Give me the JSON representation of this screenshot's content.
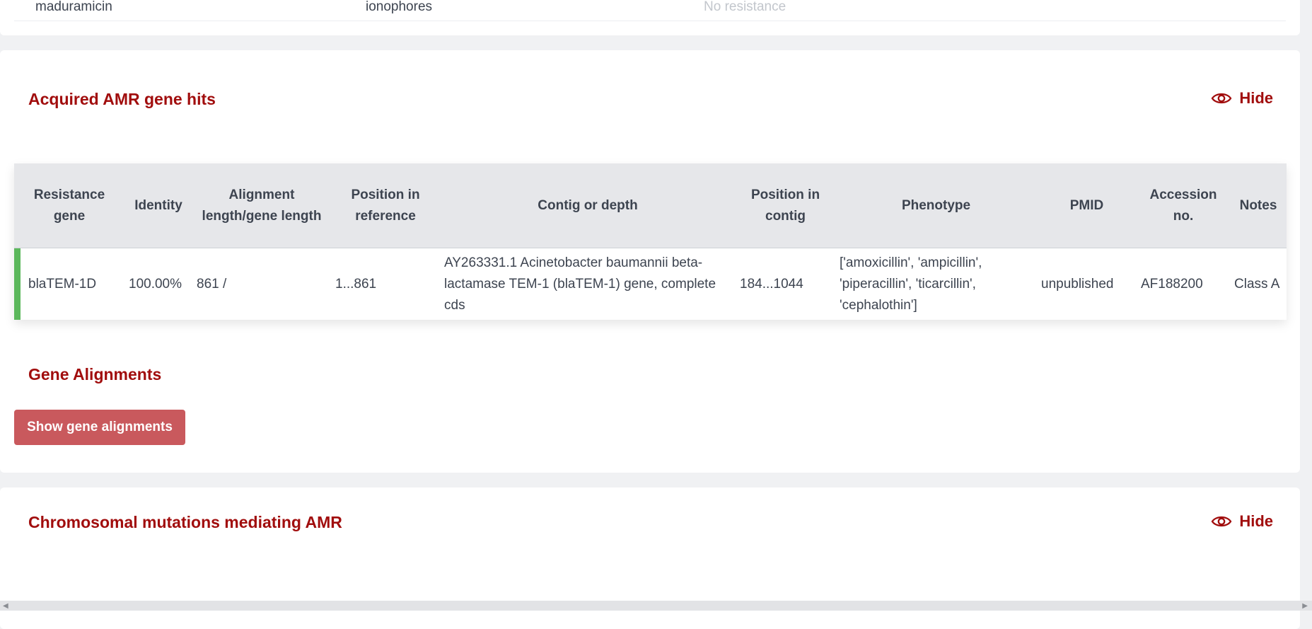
{
  "previous_row": {
    "name": "maduramicin",
    "class": "ionophores",
    "status": "No resistance"
  },
  "amr_section": {
    "title": "Acquired AMR gene hits",
    "hide_label": "Hide",
    "table": {
      "headers": [
        "Resistance gene",
        "Identity",
        "Alignment length/gene length",
        "Position in reference",
        "Contig or depth",
        "Position in contig",
        "Phenotype",
        "PMID",
        "Accession no.",
        "Notes"
      ],
      "rows": [
        {
          "gene": "blaTEM-1D",
          "identity": "100.00%",
          "alignment": "861 /",
          "pos_ref": "1...861",
          "contig": "AY263331.1 Acinetobacter baumannii beta-lactamase TEM-1 (blaTEM-1) gene, complete cds",
          "pos_contig": "184...1044",
          "phenotype": "['amoxicillin', 'ampicillin', 'piperacillin', 'ticarcillin', 'cephalothin']",
          "pmid": "unpublished",
          "accession": "AF188200",
          "notes": "Class A",
          "status_color": "#5cb85c"
        }
      ]
    },
    "alignments_title": "Gene Alignments",
    "show_alignments_label": "Show gene alignments"
  },
  "chrom_section": {
    "title": "Chromosomal mutations mediating AMR",
    "hide_label": "Hide"
  },
  "colors": {
    "accent": "#a10d0d",
    "button": "#c9595d",
    "hit_bar": "#5cb85c"
  },
  "icons": {
    "hide": "eye-icon"
  }
}
